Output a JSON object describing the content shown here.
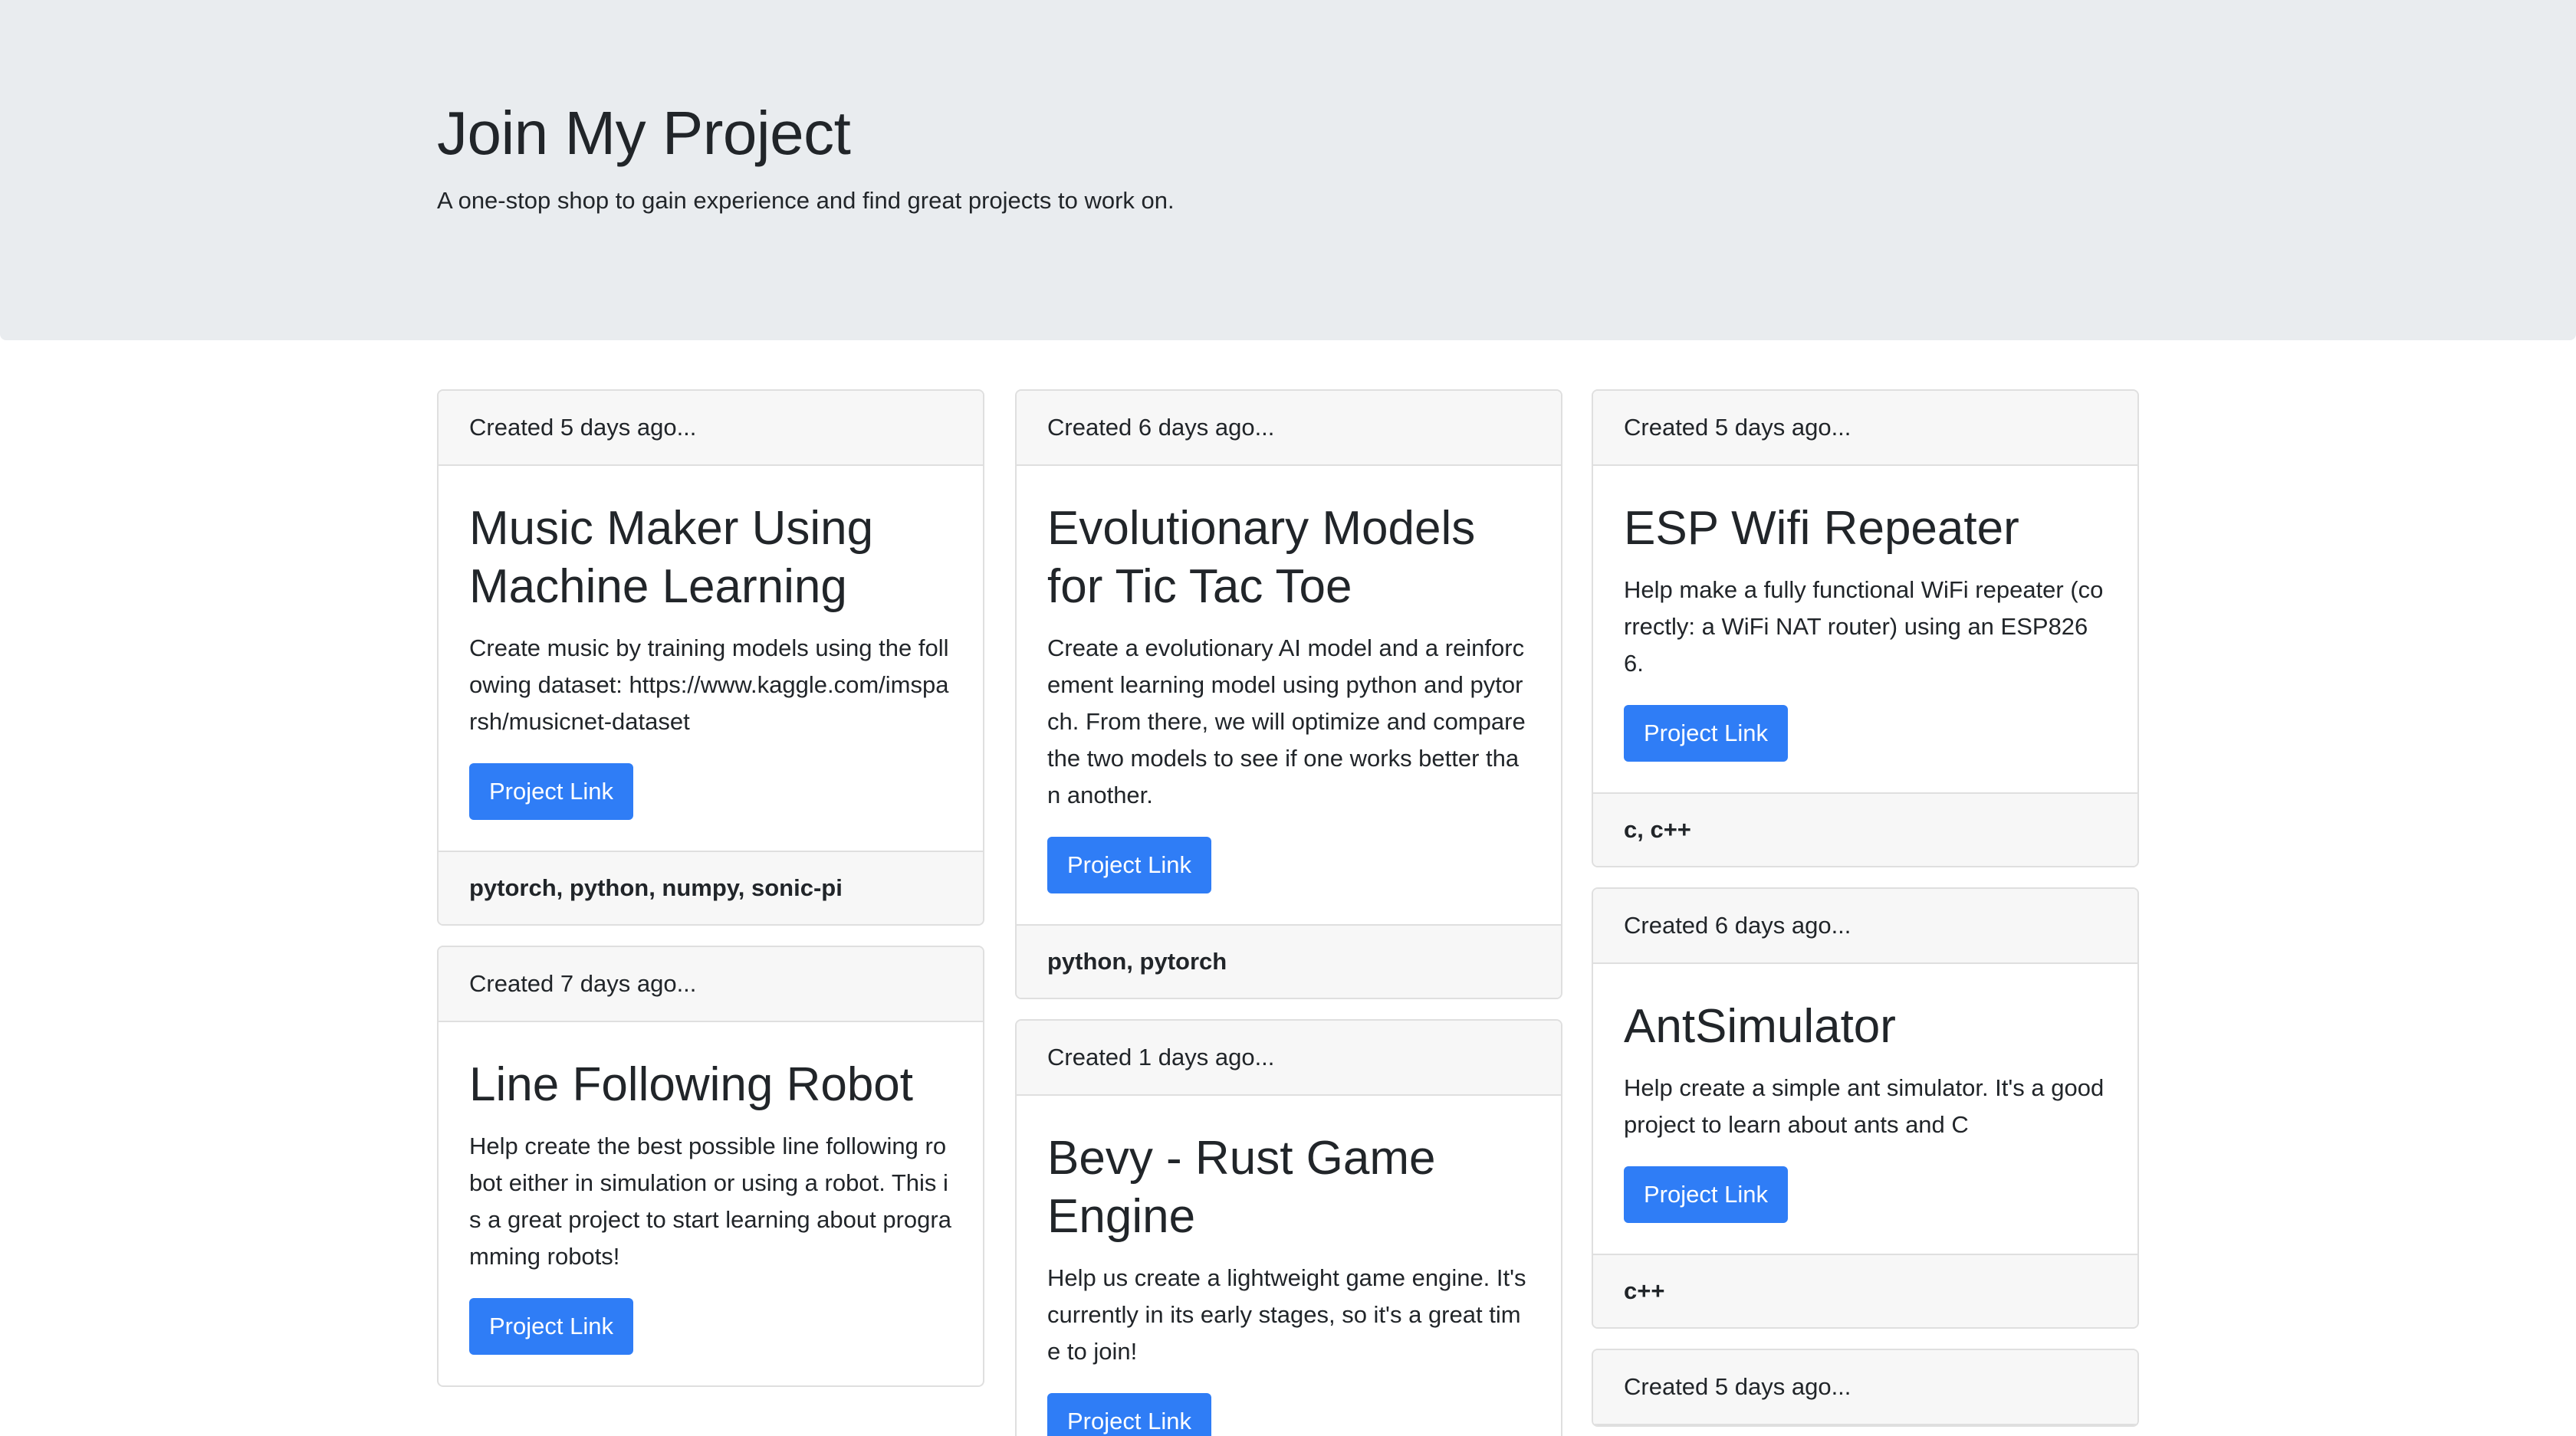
{
  "header": {
    "title": "Join My Project",
    "subtitle": "A one-stop shop to gain experience and find great projects to work on."
  },
  "columns": [
    {
      "cards": [
        {
          "created": "Created 5 days ago...",
          "title": "Music Maker Using Machine Learning",
          "description": "Create music by training models using the following dataset: https://www.kaggle.com/imsparsh/musicnet-dataset",
          "button": "Project Link",
          "tags": "pytorch, python, numpy, sonic-pi"
        },
        {
          "created": "Created 7 days ago...",
          "title": "Line Following Robot",
          "description": "Help create the best possible line following robot either in simulation or using a robot. This is a great project to start learning about programming robots!",
          "button": "Project Link",
          "tags": ""
        }
      ]
    },
    {
      "cards": [
        {
          "created": "Created 6 days ago...",
          "title": "Evolutionary Models for Tic Tac Toe",
          "description": "Create a evolutionary AI model and a reinforcement learning model using python and pytorch. From there, we will optimize and compare the two models to see if one works better than another.",
          "button": "Project Link",
          "tags": "python, pytorch"
        },
        {
          "created": "Created 1 days ago...",
          "title": "Bevy - Rust Game Engine",
          "description": "Help us create a lightweight game engine. It's currently in its early stages, so it's a great time to join!",
          "button": "Project Link",
          "tags": ""
        }
      ]
    },
    {
      "cards": [
        {
          "created": "Created 5 days ago...",
          "title": "ESP Wifi Repeater",
          "description": "Help make a fully functional WiFi repeater (correctly: a WiFi NAT router) using an ESP8266.",
          "button": "Project Link",
          "tags": "c, c++"
        },
        {
          "created": "Created 6 days ago...",
          "title": "AntSimulator",
          "description": "Help create a simple ant simulator. It's a good project to learn about ants and C",
          "button": "Project Link",
          "tags": "c++"
        },
        {
          "created": "Created 5 days ago...",
          "title": "",
          "description": "",
          "button": "",
          "tags": ""
        }
      ]
    }
  ]
}
